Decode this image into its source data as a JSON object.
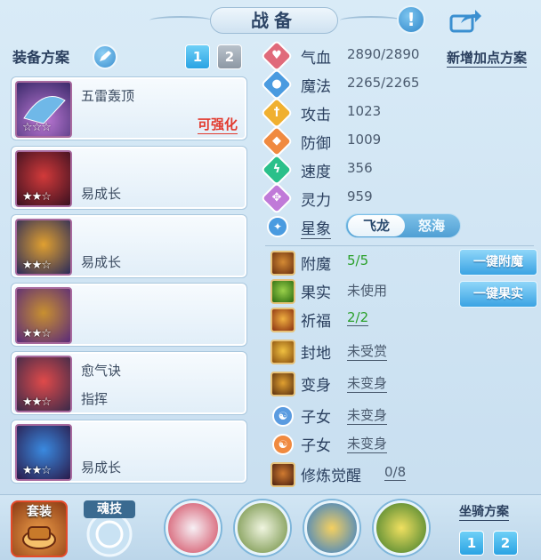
{
  "header": {
    "title": "战备"
  },
  "equipment": {
    "heading": "装备方案",
    "plan_buttons": [
      "1",
      "2"
    ],
    "slots": [
      {
        "name": "五雷轰顶",
        "sub": "",
        "tag": "可强化",
        "stars": "☆☆☆"
      },
      {
        "name": "",
        "sub": "易成长",
        "tag": "",
        "stars": "★★☆"
      },
      {
        "name": "",
        "sub": "易成长",
        "tag": "",
        "stars": "★★☆"
      },
      {
        "name": "",
        "sub": "",
        "tag": "",
        "stars": "★★☆"
      },
      {
        "name": "愈气诀",
        "sub": "指挥",
        "tag": "",
        "stars": "★★☆"
      },
      {
        "name": "",
        "sub": "易成长",
        "tag": "",
        "stars": "★★☆"
      }
    ]
  },
  "stats": {
    "add_points_label": "新增加点方案",
    "rows": [
      {
        "label": "气血",
        "value": "2890/2890",
        "icon": "heart-icon",
        "color": "#e06a7a"
      },
      {
        "label": "魔法",
        "value": "2265/2265",
        "icon": "mana-icon",
        "color": "#4a9be0"
      },
      {
        "label": "攻击",
        "value": "1023",
        "icon": "sword-icon",
        "color": "#f0b030"
      },
      {
        "label": "防御",
        "value": "1009",
        "icon": "shield-icon",
        "color": "#f08a40"
      },
      {
        "label": "速度",
        "value": "356",
        "icon": "speed-icon",
        "color": "#2ac08a"
      },
      {
        "label": "灵力",
        "value": "959",
        "icon": "spirit-icon",
        "color": "#c07ad8"
      }
    ],
    "constellation": {
      "label": "星象",
      "options": [
        "飞龙",
        "怒海"
      ],
      "selected": "飞龙"
    }
  },
  "extras": [
    {
      "label": "附魔",
      "value": "5/5",
      "style": "green",
      "icon": "enchant-icon"
    },
    {
      "label": "果实",
      "value": "未使用",
      "style": "plain",
      "icon": "fruit-icon"
    },
    {
      "label": "祈福",
      "value": "2/2",
      "style": "green",
      "icon": "blessing-icon"
    },
    {
      "label": "封地",
      "value": "未受赏",
      "style": "link",
      "icon": "fief-icon"
    },
    {
      "label": "变身",
      "value": "未变身",
      "style": "link",
      "icon": "transform-icon"
    },
    {
      "label": "子女",
      "value": "未变身",
      "style": "link",
      "icon": "child-icon"
    },
    {
      "label": "子女",
      "value": "未变身",
      "style": "link",
      "icon": "child-icon"
    },
    {
      "label": "修炼觉醒",
      "value": "0/8",
      "style": "link",
      "icon": "cultivation-icon"
    }
  ],
  "actions": {
    "enchant_all": "一键附魔",
    "fruit_all": "一键果实"
  },
  "bottom": {
    "suit_label": "套装",
    "soul_label": "魂技",
    "mount_label": "坐骑方案",
    "mount_buttons": [
      "1",
      "2"
    ]
  }
}
